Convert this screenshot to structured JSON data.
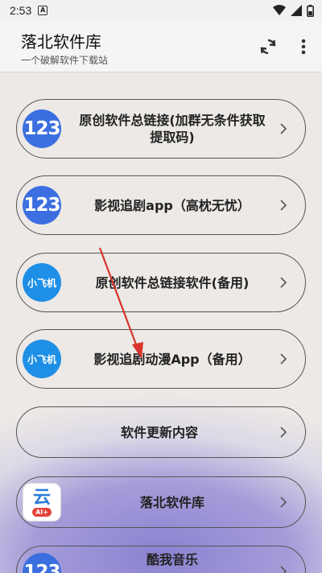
{
  "status_bar": {
    "time": "2:53",
    "notification_icon": "A"
  },
  "app_bar": {
    "title": "落北软件库",
    "subtitle": "一个破解软件下载站"
  },
  "icons": {
    "num": "123",
    "fly": "小飞机",
    "yun": "云",
    "yun_badge": "AI+"
  },
  "cards": [
    {
      "label": "原创软件总链接(加群无条件获取提取码)"
    },
    {
      "label": "影视追剧app（高枕无忧）"
    },
    {
      "label": "原创软件总链接软件(备用)"
    },
    {
      "label": "影视追剧动漫App（备用）"
    },
    {
      "label": "软件更新内容"
    },
    {
      "label": "落北软件库"
    },
    {
      "label": "酷我音乐"
    }
  ],
  "colors": {
    "arrow": "#d9342b",
    "accent_blue": "#3b6fe0",
    "bottom_glow": "#8b82d1"
  }
}
